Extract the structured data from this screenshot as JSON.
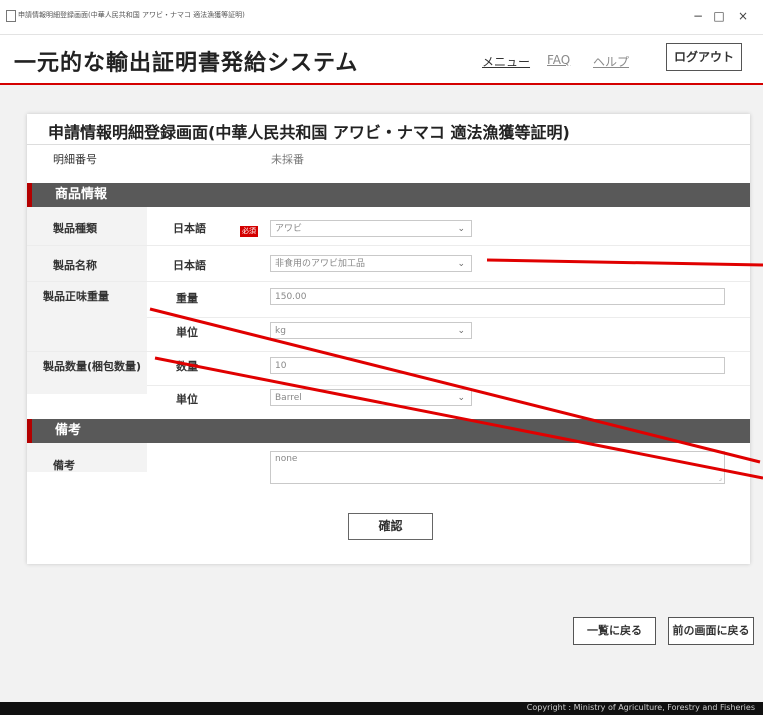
{
  "window": {
    "title": "申請情報明細登録画面(中華人民共和国 アワビ・ナマコ 適法漁獲等証明)",
    "min": "−",
    "max": "□",
    "close": "×"
  },
  "header": {
    "app_title": "一元的な輸出証明書発給システム",
    "nav": [
      "メニュー",
      "FAQ",
      "ヘルプ"
    ],
    "logout": "ログアウト"
  },
  "page": {
    "title": "申請情報明細登録画面(中華人民共和国 アワビ・ナマコ 適法漁獲等証明)",
    "detail_no_label": "明細番号",
    "detail_no_value": "未採番"
  },
  "product_section": {
    "title": "商品情報",
    "type_label": "製品種類",
    "name_label": "製品名称",
    "net_weight_label": "製品正味重量",
    "quantity_label": "製品数量(梱包数量)",
    "lang_label": "日本語",
    "required_badge": "必須",
    "weight_label": "重量",
    "unit_label": "単位",
    "count_label": "数量",
    "type_value": "アワビ",
    "name_value": "非食用のアワビ加工品",
    "weight_value": "150.00",
    "weight_unit_value": "kg",
    "count_value": "10",
    "count_unit_value": "Barrel"
  },
  "remarks_section": {
    "title": "備考",
    "label": "備考",
    "value": "none"
  },
  "buttons": {
    "confirm": "確認",
    "back_to_list": "一覧に戻る",
    "back_prev": "前の画面に戻る"
  },
  "footer": {
    "copyright": "Copyright : Ministry of Agriculture, Forestry and Fisheries"
  },
  "colors": {
    "accent_red": "#d40000",
    "section_gray": "#595959",
    "arrow_red": "#e00000"
  }
}
